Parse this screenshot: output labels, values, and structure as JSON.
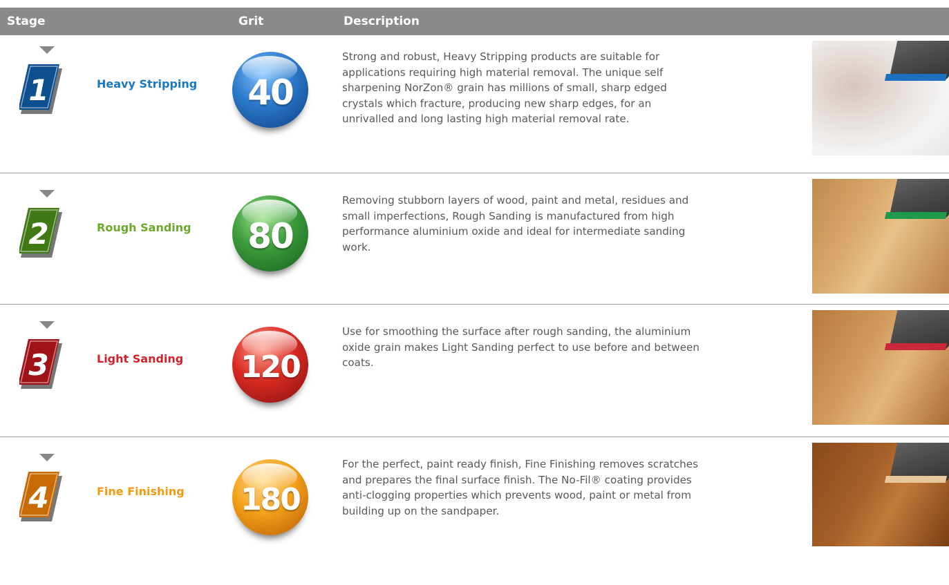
{
  "header": {
    "stage": "Stage",
    "grit": "Grit",
    "description": "Description"
  },
  "colors": {
    "header_bg": "#8a8a8a",
    "divider": "#9a9a9a"
  },
  "stages": [
    {
      "number": "1",
      "name": "Heavy Stripping",
      "grit": "40",
      "color": "#1a78c2",
      "lines": [
        "Strong and robust, Heavy Stripping products are suitable for",
        "applications requiring high material removal. The unique self",
        "sharpening NorZon® grain has millions of small, sharp edged",
        "crystals which fracture, producing new sharp edges, for an",
        "unrivalled and long lasting high material removal rate."
      ]
    },
    {
      "number": "2",
      "name": "Rough Sanding",
      "grit": "80",
      "color": "#6aaa2a",
      "lines": [
        "Removing stubborn layers of wood, paint and metal, residues and",
        "small imperfections, Rough Sanding is manufactured from high",
        "performance aluminium oxide and ideal for intermediate sanding",
        "work."
      ]
    },
    {
      "number": "3",
      "name": "Light Sanding",
      "grit": "120",
      "color": "#d3202a",
      "lines": [
        "Use for smoothing the surface after rough sanding, the aluminium",
        "oxide grain makes Light Sanding perfect to use before and between",
        "coats."
      ]
    },
    {
      "number": "4",
      "name": "Fine Finishing",
      "grit": "180",
      "color": "#f39a12",
      "lines": [
        "For the perfect, paint ready finish, Fine Finishing removes scratches",
        "and prepares the final surface finish. The No-Fil®  coating provides",
        "anti-clogging properties which prevents wood, paint or metal from",
        "building up on the sandpaper."
      ]
    }
  ]
}
